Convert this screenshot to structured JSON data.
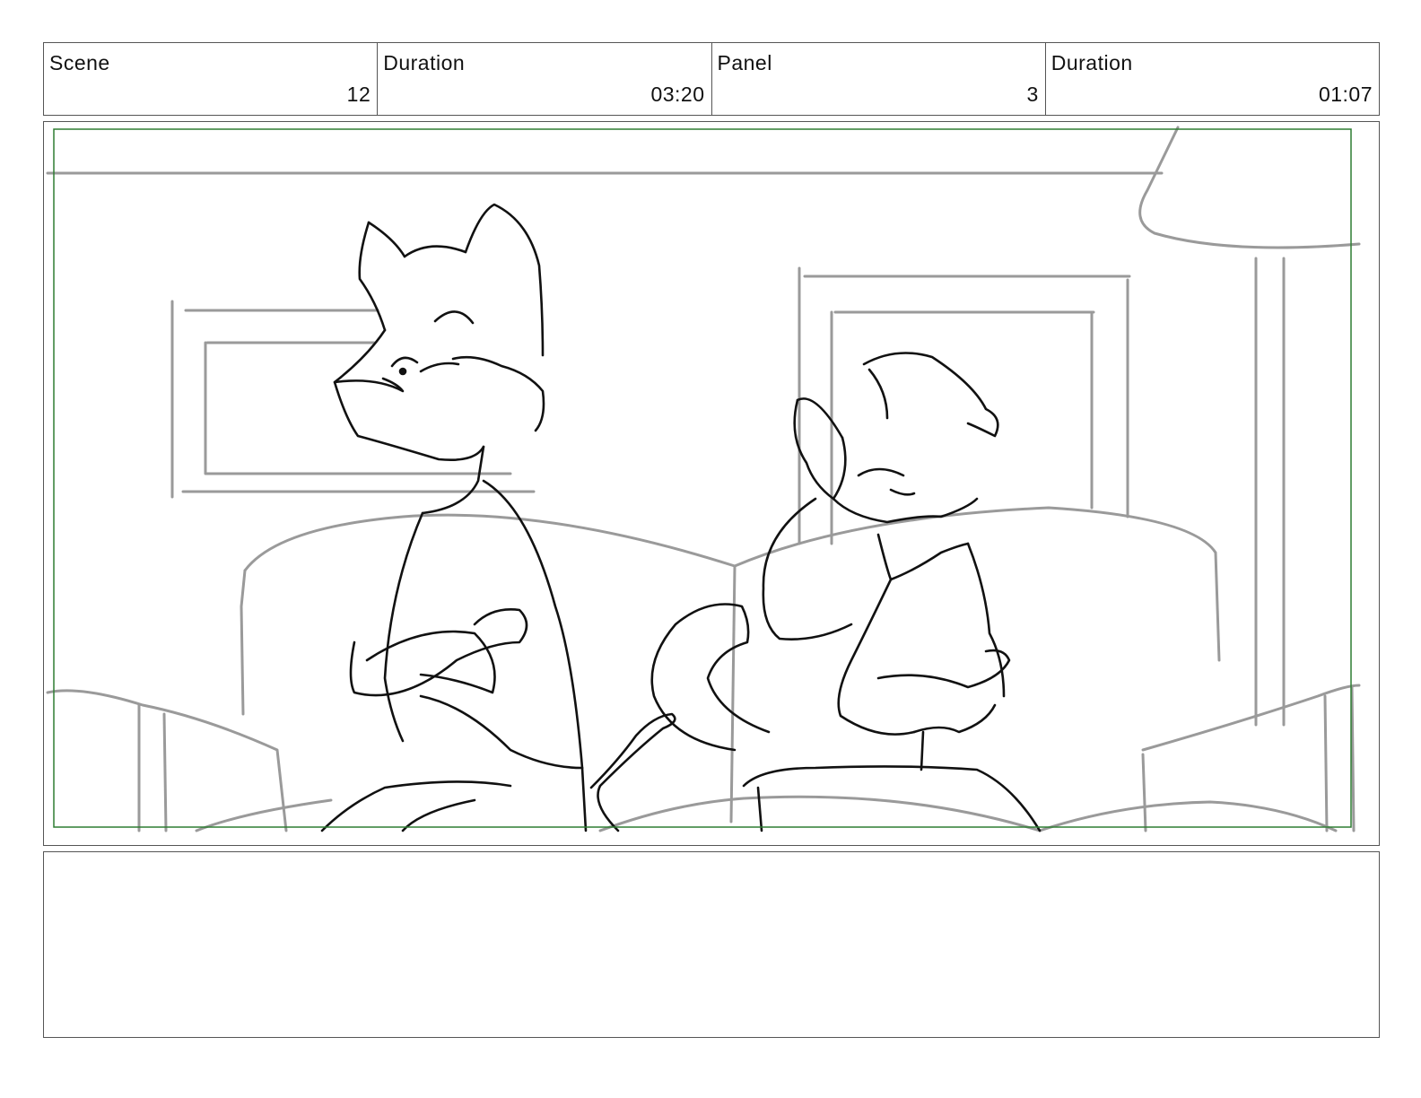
{
  "header": {
    "scene": {
      "label": "Scene",
      "value": "12"
    },
    "scene_duration": {
      "label": "Duration",
      "value": "03:20"
    },
    "panel": {
      "label": "Panel",
      "value": "3"
    },
    "panel_duration": {
      "label": "Duration",
      "value": "01:07"
    }
  },
  "colors": {
    "border": "#555555",
    "safe_frame": "#2e7d32",
    "background_sketch": "#999999",
    "character_ink": "#111111"
  },
  "notes": {
    "text": ""
  }
}
